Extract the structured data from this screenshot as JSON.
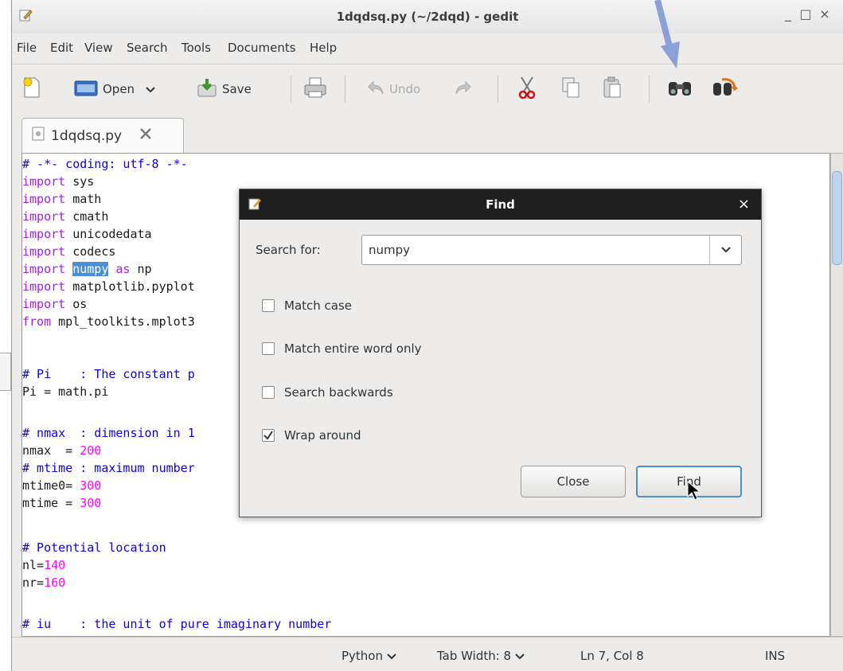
{
  "window": {
    "title": "1dqdsq.py (~/2dqd) - gedit",
    "minimize_glyph": "_",
    "maximize_glyph": "□",
    "close_glyph": "×"
  },
  "menu": [
    "File",
    "Edit",
    "View",
    "Search",
    "Tools",
    "Documents",
    "Help"
  ],
  "toolbar": {
    "open_label": "Open",
    "save_label": "Save",
    "undo_label": "Undo"
  },
  "tab": {
    "label": "1dqdsq.py"
  },
  "editor": {
    "lines": [
      "# -*- coding: utf-8 -*-",
      "import sys",
      "import math",
      "import cmath",
      "import unicodedata",
      "import codecs",
      "import numpy as np",
      "import matplotlib.pyplot",
      "import os",
      "from mpl_toolkits.mplot3",
      "",
      "# Pi    : The constant p",
      "Pi = math.pi",
      "",
      "# nmax  : dimension in 1",
      "nmax  = 200",
      "# mtime : maximum number",
      "mtime0= 300",
      "mtime = 300",
      "",
      "# Potential location",
      "nl=140",
      "nr=160",
      "",
      "# iu    : the unit of pure imaginary number"
    ]
  },
  "statusbar": {
    "language": "Python",
    "tab_width": "Tab Width: 8",
    "position": "Ln 7, Col 8",
    "mode": "INS"
  },
  "find_dialog": {
    "title": "Find",
    "search_label": "Search for:",
    "search_value": "numpy",
    "options": [
      {
        "label": "Match case",
        "checked": false
      },
      {
        "label": "Match entire word only",
        "checked": false
      },
      {
        "label": "Search backwards",
        "checked": false
      },
      {
        "label": "Wrap around",
        "checked": true
      }
    ],
    "close_label": "Close",
    "find_label": "Find",
    "close_glyph": "×"
  },
  "colors": {
    "comment": "#0c00e8",
    "keyword": "#a020f0",
    "number": "#ff00ff",
    "selection": "#4a90d9",
    "annotation_arrow": "#8aa0d6"
  }
}
